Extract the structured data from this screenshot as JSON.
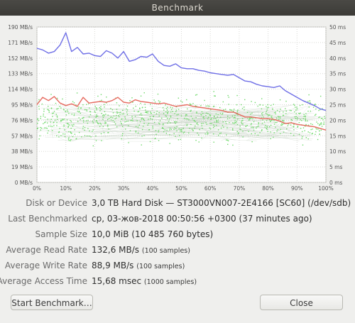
{
  "window": {
    "title": "Benchmark"
  },
  "chart_data": {
    "type": "line",
    "xlabel": "",
    "x_ticks": [
      "0%",
      "10%",
      "20%",
      "30%",
      "40%",
      "50%",
      "60%",
      "70%",
      "80%",
      "90%",
      "100%"
    ],
    "y_left_ticks": [
      "0 MB/s",
      "19 MB/s",
      "38 MB/s",
      "57 MB/s",
      "76 MB/s",
      "95 MB/s",
      "114 MB/s",
      "133 MB/s",
      "152 MB/s",
      "171 MB/s",
      "190 MB/s"
    ],
    "y_right_ticks": [
      "0 ms",
      "5 ms",
      "10 ms",
      "15 ms",
      "20 ms",
      "25 ms",
      "30 ms",
      "35 ms",
      "40 ms",
      "45 ms",
      "50 ms"
    ],
    "ylim": [
      0,
      190
    ],
    "y2lim": [
      0,
      50
    ],
    "grid": true,
    "series": [
      {
        "color": "#6f6fe6",
        "x": [
          0,
          2,
          4,
          6,
          8,
          10,
          12,
          14,
          16,
          18,
          20,
          22,
          24,
          26,
          28,
          30,
          32,
          34,
          36,
          38,
          40,
          42,
          44,
          46,
          48,
          50,
          52,
          54,
          56,
          58,
          60,
          62,
          64,
          66,
          68,
          70,
          72,
          74,
          76,
          78,
          80,
          82,
          84,
          86,
          88,
          90,
          92,
          94,
          96,
          98,
          100
        ],
        "values": [
          164,
          162,
          158,
          160,
          168,
          183,
          160,
          165,
          157,
          158,
          155,
          154,
          161,
          158,
          152,
          160,
          148,
          150,
          154,
          153,
          157,
          148,
          143,
          142,
          145,
          140,
          139,
          139,
          137,
          136,
          134,
          133,
          132,
          131,
          132,
          128,
          124,
          123,
          120,
          118,
          117,
          116,
          118,
          112,
          108,
          104,
          100,
          97,
          94,
          90,
          88
        ]
      },
      {
        "color": "#e66a5f",
        "x": [
          0,
          2,
          4,
          6,
          8,
          10,
          12,
          14,
          16,
          18,
          20,
          22,
          24,
          26,
          28,
          30,
          32,
          34,
          36,
          38,
          40,
          42,
          44,
          46,
          48,
          50,
          52,
          54,
          56,
          58,
          60,
          62,
          64,
          66,
          68,
          70,
          72,
          74,
          76,
          78,
          80,
          82,
          84,
          86,
          88,
          90,
          92,
          94,
          96,
          98,
          100
        ],
        "values": [
          95,
          104,
          100,
          105,
          97,
          94,
          96,
          93,
          104,
          97,
          98,
          99,
          98,
          100,
          104,
          98,
          97,
          101,
          99,
          98,
          97,
          96,
          97,
          95,
          93,
          94,
          95,
          93,
          92,
          91,
          90,
          89,
          88,
          86,
          86,
          83,
          80,
          80,
          79,
          78,
          78,
          77,
          75,
          72,
          73,
          71,
          70,
          69,
          68,
          66,
          64
        ]
      },
      {
        "color": "#6fd96a",
        "type": "scatter",
        "description_y_range": [
          40,
          115
        ],
        "typical": 64
      }
    ]
  },
  "info": {
    "rows": [
      {
        "label": "Disk or Device",
        "value": "3,0 TB Hard Disk — ST3000VN007-2E4166 [SC60] (/dev/sdb)",
        "small": ""
      },
      {
        "label": "Last Benchmarked",
        "value": "ср, 03-жов-2018 00:50:56 +0300 (37 minutes ago)",
        "small": ""
      },
      {
        "label": "Sample Size",
        "value": "10,0 MiB (10 485 760 bytes)",
        "small": ""
      },
      {
        "label": "Average Read Rate",
        "value": "132,6 MB/s",
        "small": "(100 samples)"
      },
      {
        "label": "Average Write Rate",
        "value": "88,9 MB/s",
        "small": "(100 samples)"
      },
      {
        "label": "Average Access Time",
        "value": "15,68 msec",
        "small": "(1000 samples)"
      }
    ]
  },
  "buttons": {
    "start": "Start Benchmark…",
    "close": "Close"
  }
}
